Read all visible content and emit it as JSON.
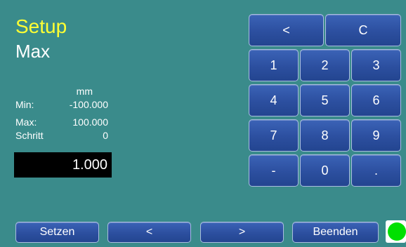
{
  "header": {
    "title": "Setup",
    "subtitle": "Max"
  },
  "info": {
    "unit": "mm",
    "min_label": "Min:",
    "min_value": "-100.000",
    "max_label": "Max:",
    "max_value": "100.000",
    "step_label": "Schritt",
    "step_value": "0"
  },
  "input": {
    "value": "1.000"
  },
  "keypad": {
    "backspace": "<",
    "clear": "C",
    "k1": "1",
    "k2": "2",
    "k3": "3",
    "k4": "4",
    "k5": "5",
    "k6": "6",
    "k7": "7",
    "k8": "8",
    "k9": "9",
    "minus": "-",
    "k0": "0",
    "dot": "."
  },
  "footer": {
    "set_label": "Setzen",
    "prev_label": "<",
    "next_label": ">",
    "exit_label": "Beenden",
    "status_color": "#00e000"
  },
  "colors": {
    "background": "#3a8b8b",
    "title": "#ffff33",
    "button": "#2c4f9f"
  }
}
